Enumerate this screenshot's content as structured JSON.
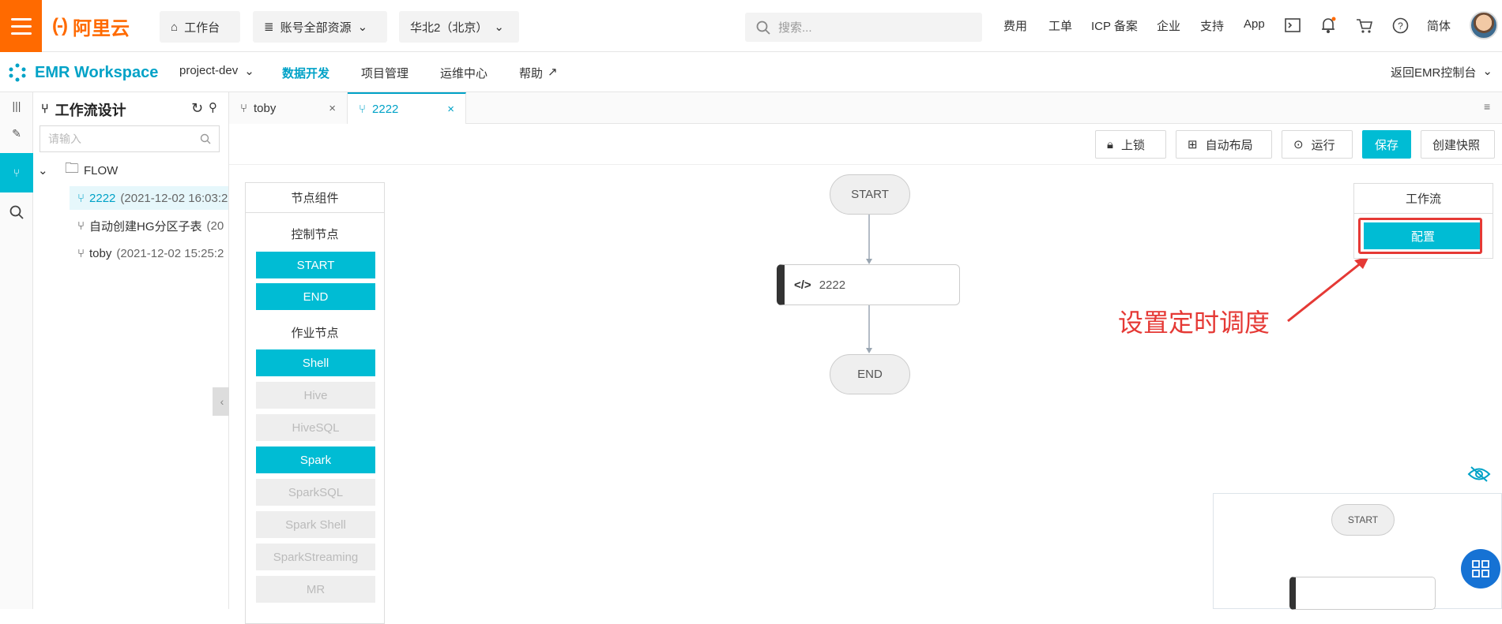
{
  "topbar": {
    "brand": "阿里云",
    "workbench": "工作台",
    "resources": "账号全部资源",
    "region": "华北2（北京）",
    "search_placeholder": "搜索...",
    "nav": [
      "费用",
      "工单",
      "ICP 备案",
      "企业",
      "支持",
      "App"
    ],
    "lang": "简体"
  },
  "secbar": {
    "product": "EMR Workspace",
    "project": "project-dev",
    "nav": [
      "数据开发",
      "项目管理",
      "运维中心",
      "帮助"
    ],
    "back": "返回EMR控制台"
  },
  "tree": {
    "title": "工作流设计",
    "search_placeholder": "请输入",
    "folder": "FLOW",
    "items": [
      {
        "name": "2222",
        "meta": "(2021-12-02 16:03:2"
      },
      {
        "name": "自动创建HG分区子表",
        "meta": "(20"
      },
      {
        "name": "toby",
        "meta": "(2021-12-02 15:25:2"
      }
    ]
  },
  "tabs": [
    {
      "label": "toby",
      "close": "×"
    },
    {
      "label": "2222",
      "close": "×"
    }
  ],
  "toolbar": {
    "lock": "上锁",
    "autolayout": "自动布局",
    "run": "运行",
    "save": "保存",
    "snapshot": "创建快照"
  },
  "palette": {
    "title": "节点组件",
    "control_title": "控制节点",
    "control": [
      {
        "label": "START",
        "enabled": true
      },
      {
        "label": "END",
        "enabled": true
      }
    ],
    "job_title": "作业节点",
    "jobs": [
      {
        "label": "Shell",
        "enabled": true
      },
      {
        "label": "Hive",
        "enabled": false
      },
      {
        "label": "HiveSQL",
        "enabled": false
      },
      {
        "label": "Spark",
        "enabled": true
      },
      {
        "label": "SparkSQL",
        "enabled": false
      },
      {
        "label": "Spark Shell",
        "enabled": false
      },
      {
        "label": "SparkStreaming",
        "enabled": false
      },
      {
        "label": "MR",
        "enabled": false
      }
    ]
  },
  "graph": {
    "start": "START",
    "task": "2222",
    "end": "END"
  },
  "workflow_panel": {
    "title": "工作流",
    "config": "配置"
  },
  "annotation": "设置定时调度",
  "minimap": {
    "start": "START"
  },
  "colors": {
    "accent": "#00bcd4",
    "brand": "#ff6a00",
    "annotation": "#e53935"
  }
}
